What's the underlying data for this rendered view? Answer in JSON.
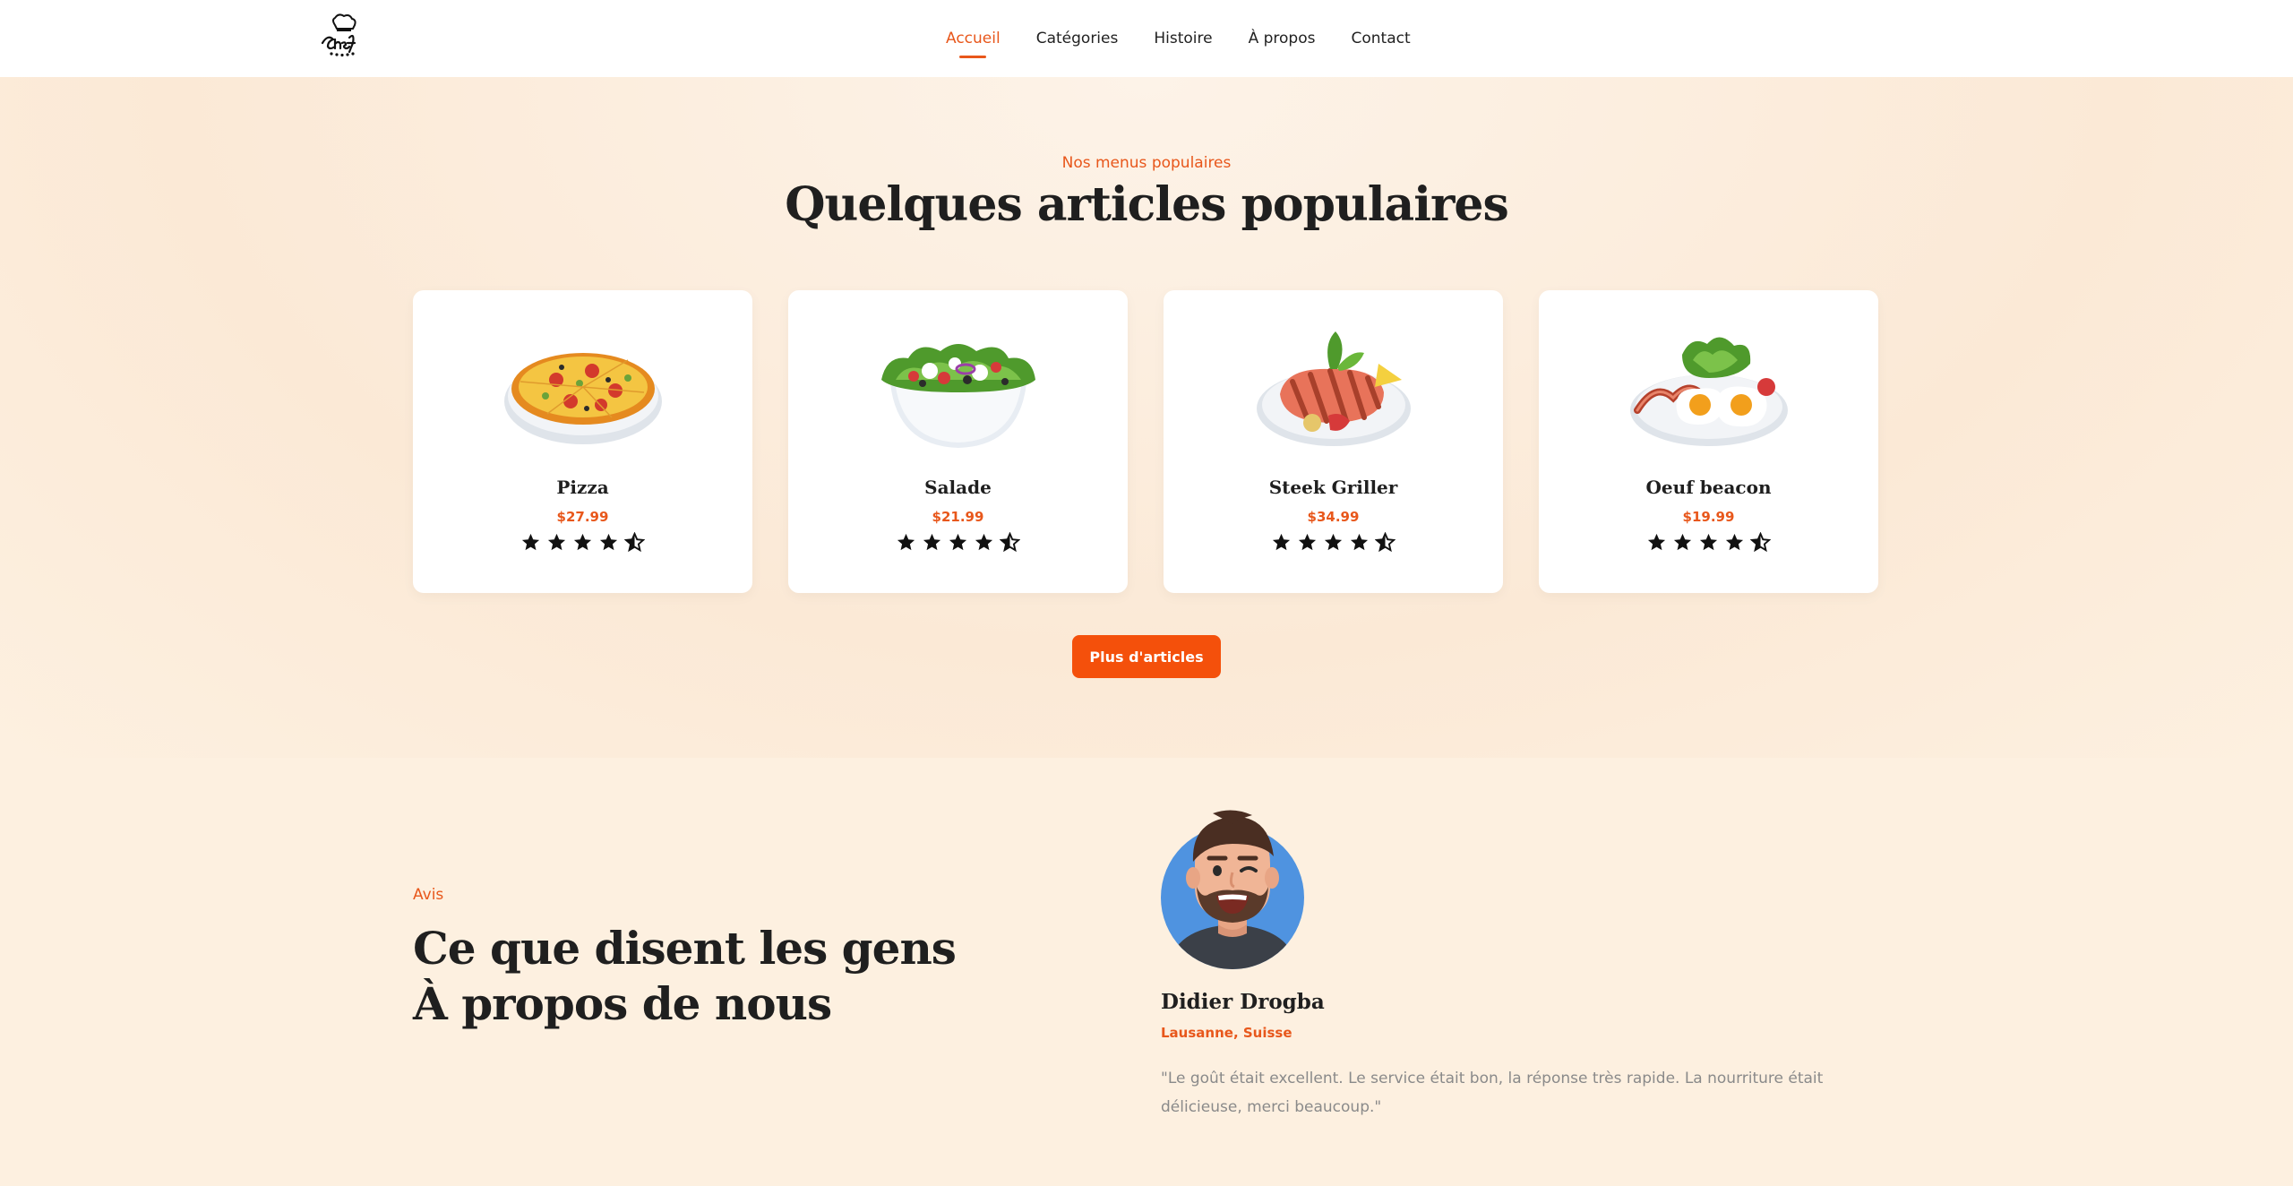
{
  "header": {
    "nav": [
      {
        "label": "Accueil",
        "active": true
      },
      {
        "label": "Catégories",
        "active": false
      },
      {
        "label": "Histoire",
        "active": false
      },
      {
        "label": "À propos",
        "active": false
      },
      {
        "label": "Contact",
        "active": false
      }
    ]
  },
  "popular": {
    "eyebrow": "Nos menus populaires",
    "title": "Quelques articles populaires",
    "items": [
      {
        "name": "Pizza",
        "price": "$27.99",
        "rating": 4.5,
        "image": "pizza-image"
      },
      {
        "name": "Salade",
        "price": "$21.99",
        "rating": 4.5,
        "image": "salad-image"
      },
      {
        "name": "Steek Griller",
        "price": "$34.99",
        "rating": 4.5,
        "image": "grilled-steak-image"
      },
      {
        "name": "Oeuf beacon",
        "price": "$19.99",
        "rating": 4.5,
        "image": "egg-bacon-image"
      }
    ],
    "more_button": "Plus d'articles"
  },
  "testimonial": {
    "eyebrow": "Avis",
    "title_line1": "Ce que disent les gens",
    "title_line2": "À propos de nous",
    "reviewer_name": "Didier Drogba",
    "reviewer_location": "Lausanne, Suisse",
    "quote": "\"Le goût était excellent. Le service était bon, la réponse très rapide. La nourriture était délicieuse, merci beaucoup.\""
  },
  "colors": {
    "accent": "#e8571b",
    "button": "#f4500b",
    "background": "#fdf0e0"
  }
}
